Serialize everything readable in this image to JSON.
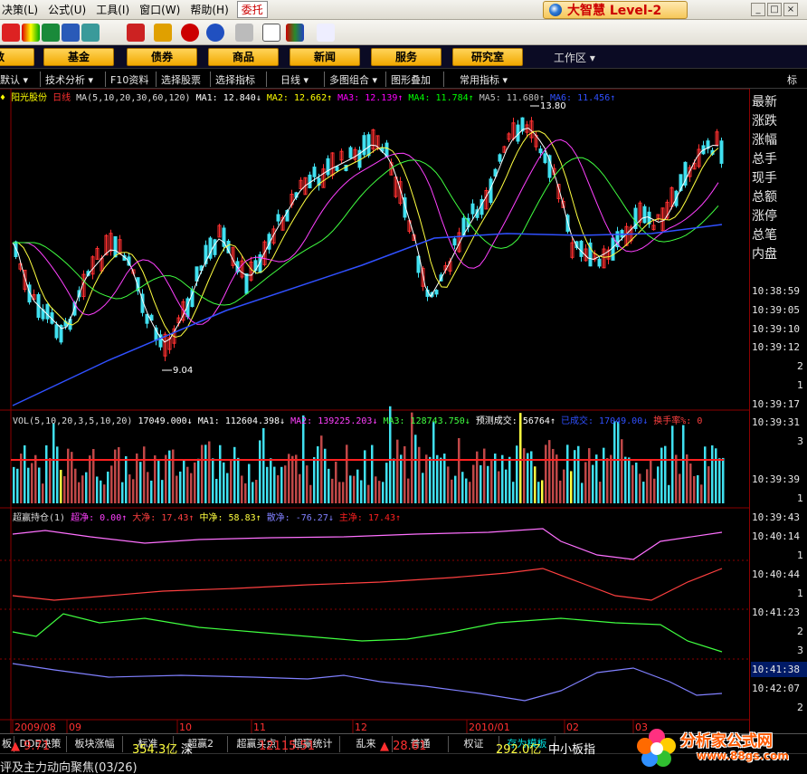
{
  "menu": {
    "items": [
      "决策(L)",
      "公式(U)",
      "工具(I)",
      "窗口(W)",
      "帮助(H)"
    ],
    "active": "委托"
  },
  "brand": {
    "title": "大智慧 Level-2"
  },
  "window_controls": [
    "_",
    "□",
    "×"
  ],
  "funcbar": {
    "buttons": [
      "数",
      "基金",
      "债券",
      "商品",
      "新闻",
      "服务",
      "研究室"
    ],
    "workspace": "工作区 ▾"
  },
  "subbar": {
    "items": [
      "默认 ▾",
      "技术分析 ▾",
      "F10资料",
      "选择股票",
      "选择指标",
      "日线 ▾",
      "多图组合 ▾",
      "图形叠加",
      "常用指标 ▾",
      "标"
    ]
  },
  "price_legend": {
    "stock": "阳光股份",
    "period": "日线",
    "ma_label": "MA(5,10,20,30,60,120)",
    "ma": [
      {
        "name": "MA1",
        "value": "12.840↓",
        "color": "#ffffff"
      },
      {
        "name": "MA2",
        "value": "12.662↑",
        "color": "#ffff00"
      },
      {
        "name": "MA3",
        "value": "12.139↑",
        "color": "#ff00ff"
      },
      {
        "name": "MA4",
        "value": "11.784↑",
        "color": "#00ff00"
      },
      {
        "name": "MA5",
        "value": "11.680↑",
        "color": "#c0c0c0"
      },
      {
        "name": "MA6",
        "value": "11.456↑",
        "color": "#3050ff"
      }
    ],
    "high_label": "13.80",
    "low_label": "9.04"
  },
  "vol_legend": {
    "label": "VOL(5,10,20,3,5,10,20)",
    "value": "17049.000↓",
    "ma1": "MA1: 112604.398↓",
    "ma2": "MA2: 139225.203↓",
    "ma3": "MA3: 128743.750↓",
    "forecast": "预测成交: 56764↑",
    "done": "已成交: 17049.00↓",
    "turnover": "换手率%: 0"
  },
  "cyc_legend": {
    "label": "超赢持仓(1)",
    "super": "超净: 0.00↑",
    "big": "大净: 17.43↑",
    "mid": "中净: 58.83↑",
    "small": "散净: -76.27↓",
    "main": "主净: 17.43↑"
  },
  "x_axis": [
    "2009/08",
    "09",
    "10",
    "11",
    "12",
    "2010/01",
    "02",
    "03"
  ],
  "right_panel": {
    "labels": [
      "最新",
      "涨跌",
      "涨幅",
      "总手",
      "现手",
      "总额",
      "涨停",
      "总笔",
      "内盘"
    ],
    "times": [
      "10:38:59",
      "10:39:05",
      "10:39:10",
      "10:39:12",
      "10:39:17",
      "10:39:31",
      "10:39:39",
      "10:39:43",
      "10:40:14",
      "10:40:44",
      "10:41:23",
      "10:41:38",
      "10:42:07"
    ],
    "digits": [
      "2",
      "1",
      "3",
      "1",
      "1",
      "1",
      "2",
      "3",
      "2"
    ]
  },
  "tabs": [
    "板",
    "DDE决策",
    "板块涨幅",
    "标准",
    "超赢2",
    "超赢买点",
    "超赢统计",
    "乱来",
    "普通",
    "权证",
    "存为模板"
  ],
  "index_bar": {
    "sh_change": "▲ 9.71",
    "sh_amount": "354.3亿",
    "sz_label": "深",
    "sz_index": "12115.51",
    "sz_change": "▲ 28.61",
    "sz_amount": "292.0亿",
    "sme_label": "中小板指"
  },
  "news": "评及主力动向聚焦(03/26)",
  "watermark": {
    "text": "分析家公式网",
    "url": "www.88gs.com"
  }
}
